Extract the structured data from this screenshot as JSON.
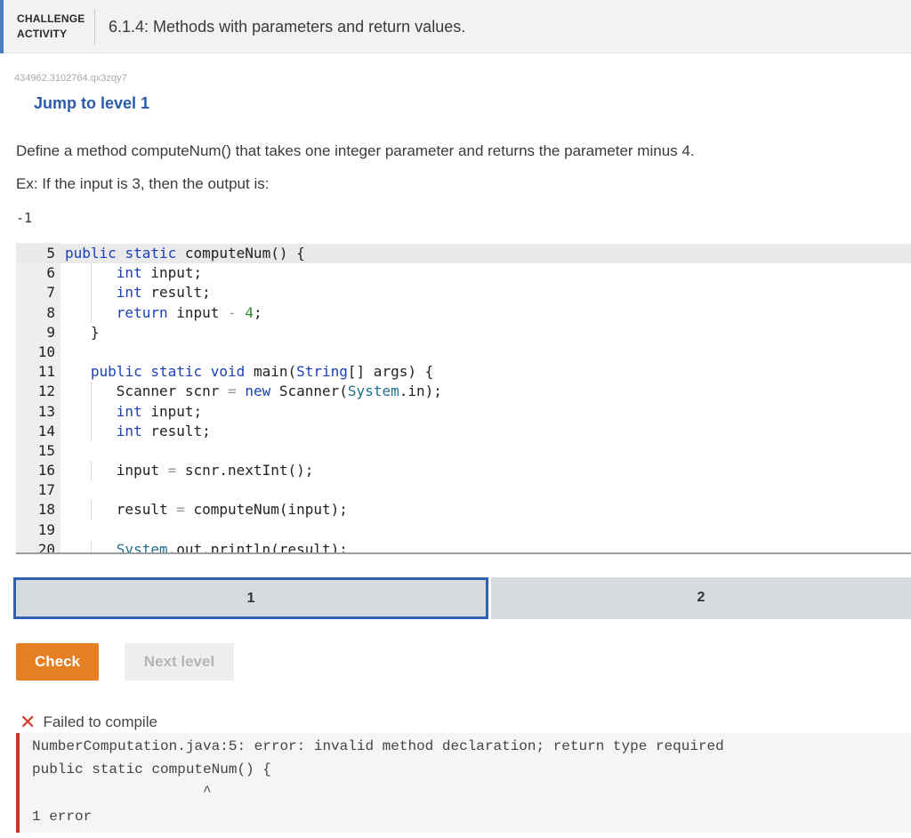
{
  "header": {
    "label_line1": "CHALLENGE",
    "label_line2": "ACTIVITY",
    "title": "6.1.4: Methods with parameters and return values."
  },
  "activity_id": "434962.3102764.qx3zqy7",
  "jump_link": "Jump to level 1",
  "prompt": "Define a method computeNum() that takes one integer parameter and returns the parameter minus 4.",
  "example_text": "Ex: If the input is 3, then the output is:",
  "example_output": "-1",
  "code_lines": [
    {
      "n": "5",
      "text": "public static computeNum() {"
    },
    {
      "n": "6",
      "text": "      int input;"
    },
    {
      "n": "7",
      "text": "      int result;"
    },
    {
      "n": "8",
      "text": "      return input - 4;"
    },
    {
      "n": "9",
      "text": "   }"
    },
    {
      "n": "10",
      "text": ""
    },
    {
      "n": "11",
      "text": "   public static void main(String[] args) {"
    },
    {
      "n": "12",
      "text": "      Scanner scnr = new Scanner(System.in);"
    },
    {
      "n": "13",
      "text": "      int input;"
    },
    {
      "n": "14",
      "text": "      int result;"
    },
    {
      "n": "15",
      "text": ""
    },
    {
      "n": "16",
      "text": "      input = scnr.nextInt();"
    },
    {
      "n": "17",
      "text": ""
    },
    {
      "n": "18",
      "text": "      result = computeNum(input);"
    },
    {
      "n": "19",
      "text": ""
    },
    {
      "n": "20",
      "text": "      System.out.println(result);"
    }
  ],
  "levels": [
    "1",
    "2"
  ],
  "buttons": {
    "check": "Check",
    "next_level": "Next level"
  },
  "result": {
    "icon": "x-icon",
    "text": "Failed to compile"
  },
  "error": {
    "line1": "NumberComputation.java:5: error: invalid method declaration; return type required",
    "line2": "public static computeNum() {",
    "line3": "                    ^",
    "line4": "1 error"
  },
  "colors": {
    "accent": "#e67e22",
    "link": "#2a5aa8",
    "error": "#c0392b",
    "active_level": "#2e62b0"
  }
}
